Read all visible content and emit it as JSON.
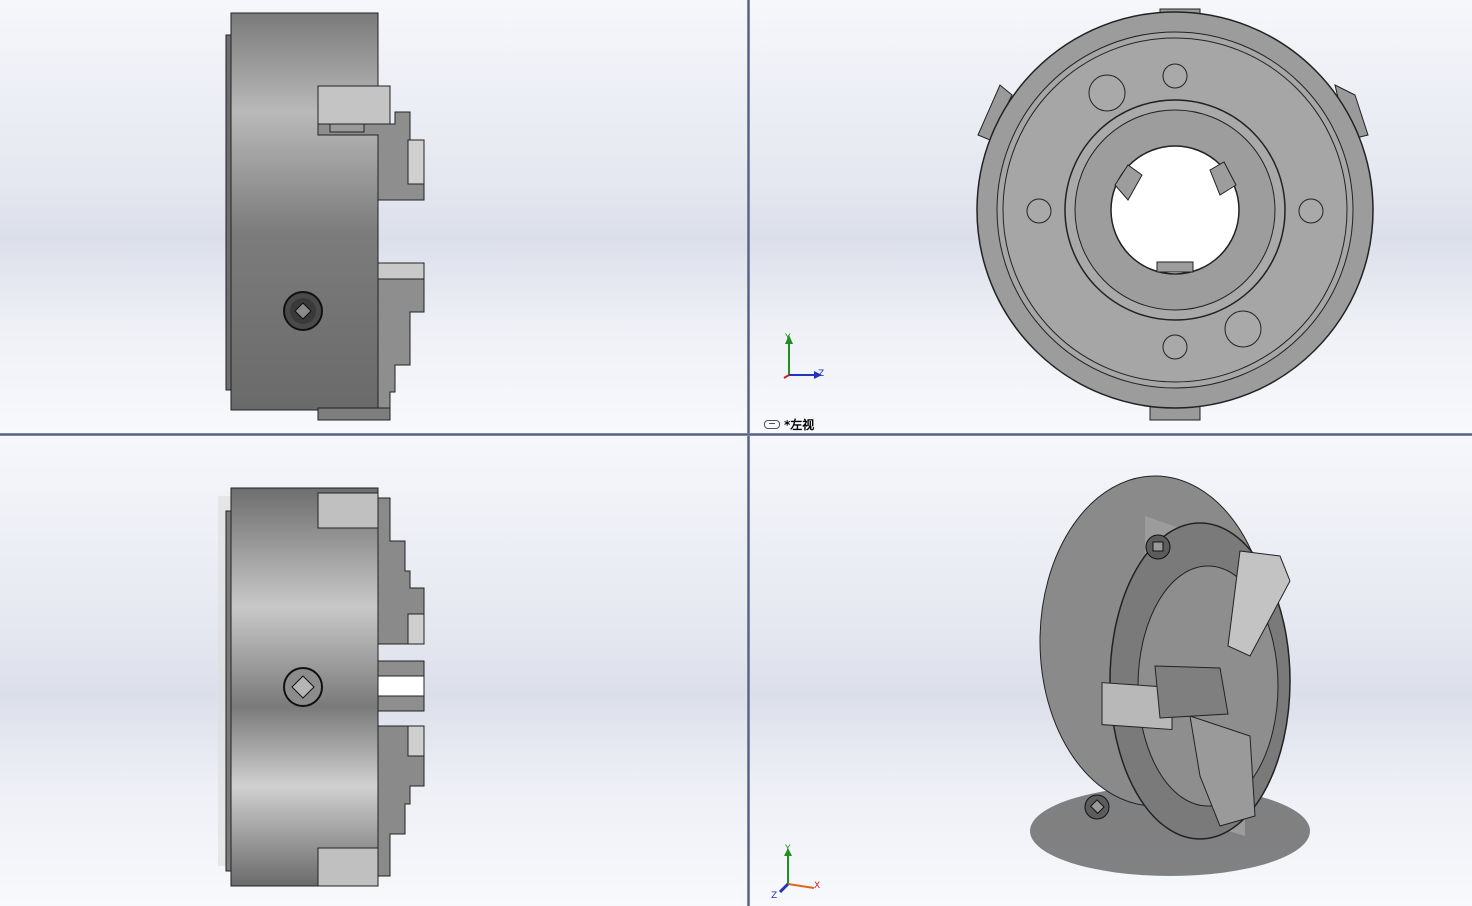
{
  "window": {
    "views": [
      {
        "id": "top-left",
        "name": "front-view"
      },
      {
        "id": "top-right",
        "name": "left-view",
        "label": "*左视"
      },
      {
        "id": "bottom-left",
        "name": "top-view"
      },
      {
        "id": "bottom-right",
        "name": "isometric-view"
      }
    ]
  },
  "triad_top_right": {
    "axis_y": "Y",
    "axis_z": "Z",
    "axis_x": "X"
  },
  "triad_bottom_right": {
    "axis_y": "Y",
    "axis_z": "Z",
    "axis_x": "X"
  },
  "colors": {
    "axis_x": "#cc2222",
    "axis_y": "#1f8f1f",
    "axis_z": "#2233bb",
    "divider": "#4b5478"
  },
  "icons": {
    "view_link": "link-icon"
  }
}
